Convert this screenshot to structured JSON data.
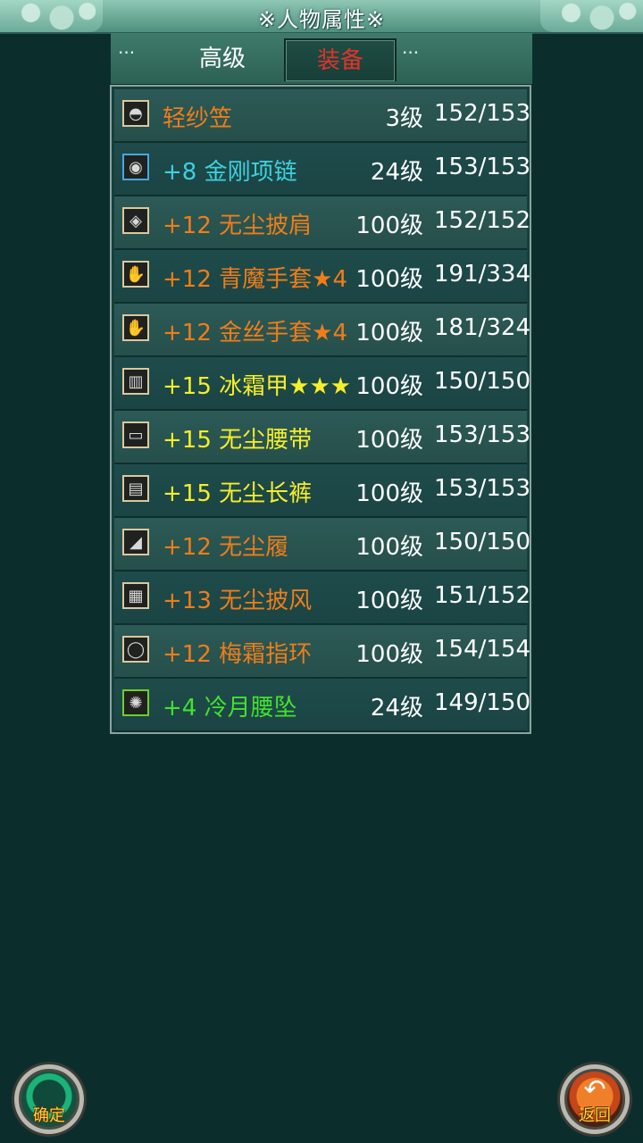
{
  "header": {
    "title": "※人物属性※"
  },
  "tabs": {
    "dots_left": "···",
    "dots_right": "···",
    "items": [
      {
        "label": "高级",
        "active": false
      },
      {
        "label": "装备",
        "active": true
      }
    ]
  },
  "equipment": [
    {
      "name": "轻纱笠",
      "level": "3级",
      "durability": "152/153",
      "color": "#ef7d1a",
      "icon": "hat-icon"
    },
    {
      "name": "+8 金刚项链",
      "level": "24级",
      "durability": "153/153",
      "color": "#3fd0df",
      "icon": "necklace-icon"
    },
    {
      "name": "+12 无尘披肩",
      "level": "100级",
      "durability": "152/152",
      "color": "#ef7d1a",
      "icon": "shoulder-icon"
    },
    {
      "name": "+12 青魔手套★4",
      "level": "100级",
      "durability": "191/334",
      "color": "#ef7d1a",
      "icon": "glove-icon"
    },
    {
      "name": "+12 金丝手套★4",
      "level": "100级",
      "durability": "181/324",
      "color": "#ef7d1a",
      "icon": "glove-icon"
    },
    {
      "name": "+15 冰霜甲★★★",
      "level": "100级",
      "durability": "150/150",
      "color": "#f6ee2a",
      "icon": "armor-icon"
    },
    {
      "name": "+15 无尘腰带",
      "level": "100级",
      "durability": "153/153",
      "color": "#f6ee2a",
      "icon": "belt-icon"
    },
    {
      "name": "+15 无尘长裤",
      "level": "100级",
      "durability": "153/153",
      "color": "#f6ee2a",
      "icon": "pants-icon"
    },
    {
      "name": "+12 无尘履",
      "level": "100级",
      "durability": "150/150",
      "color": "#ef7d1a",
      "icon": "boots-icon"
    },
    {
      "name": "+13 无尘披风",
      "level": "100级",
      "durability": "151/152",
      "color": "#ef7d1a",
      "icon": "cloak-icon"
    },
    {
      "name": "+12 梅霜指环",
      "level": "100级",
      "durability": "154/154",
      "color": "#ef7d1a",
      "icon": "ring-icon"
    },
    {
      "name": "+4 冷月腰坠",
      "level": "24级",
      "durability": "149/150",
      "color": "#44e12e",
      "icon": "pendant-icon"
    }
  ],
  "buttons": {
    "confirm_label": "确定",
    "back_label": "返回"
  }
}
